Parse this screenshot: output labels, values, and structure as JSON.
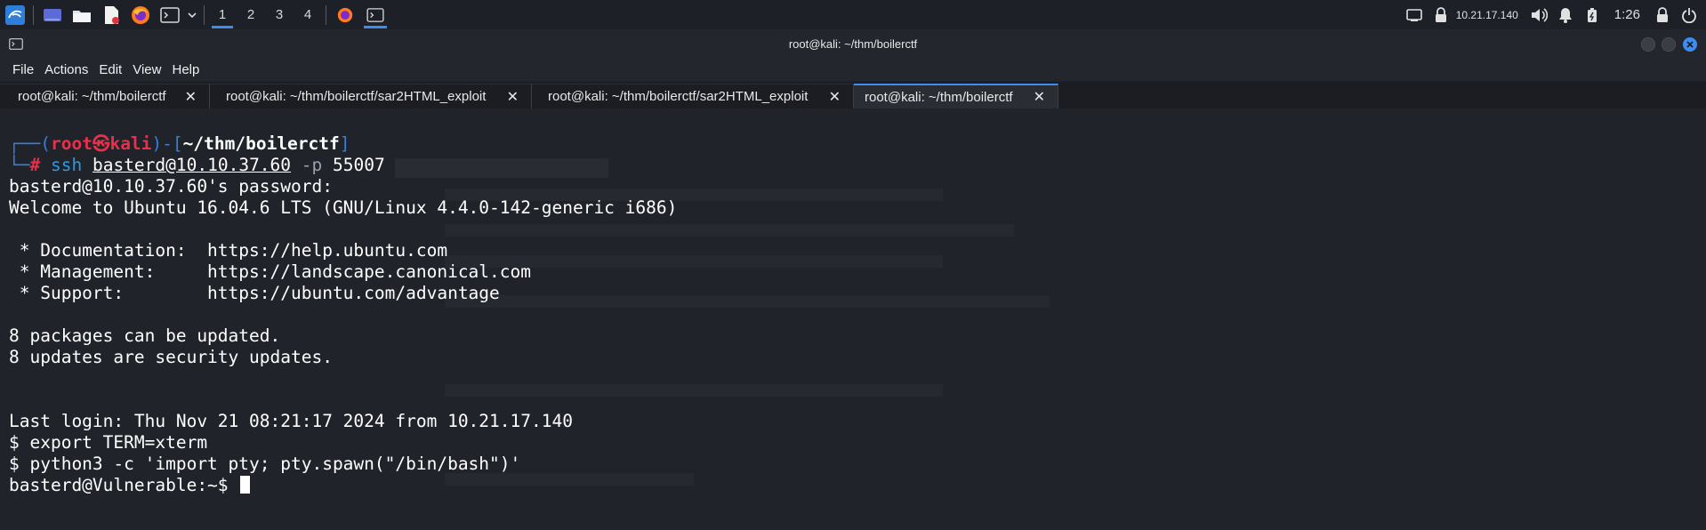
{
  "panel": {
    "workspaces": [
      "1",
      "2",
      "3",
      "4"
    ],
    "active_workspace": "1",
    "ip": "10.21.17.140",
    "clock": "1:26",
    "accent": "#3d8cf0"
  },
  "window": {
    "title": "root@kali: ~/thm/boilerctf"
  },
  "menu": [
    "File",
    "Actions",
    "Edit",
    "View",
    "Help"
  ],
  "tabs": [
    {
      "label": "root@kali: ~/thm/boilerctf"
    },
    {
      "label": "root@kali: ~/thm/boilerctf/sar2HTML_exploit"
    },
    {
      "label": "root@kali: ~/thm/boilerctf/sar2HTML_exploit"
    },
    {
      "label": "root@kali: ~/thm/boilerctf"
    }
  ],
  "terminal": {
    "prompt": {
      "user": "root",
      "at": "㉿",
      "host": "kali",
      "cwd": "~/thm/boilerctf",
      "hash": "#",
      "cmd": "ssh",
      "target": "basterd@10.10.37.60",
      "flag": "-p",
      "port": "55007"
    },
    "lines": [
      "basterd@10.10.37.60's password: ",
      "Welcome to Ubuntu 16.04.6 LTS (GNU/Linux 4.4.0-142-generic i686)",
      "",
      " * Documentation:  https://help.ubuntu.com",
      " * Management:     https://landscape.canonical.com",
      " * Support:        https://ubuntu.com/advantage",
      "",
      "8 packages can be updated.",
      "8 updates are security updates.",
      "",
      "",
      "Last login: Thu Nov 21 08:21:17 2024 from 10.21.17.140",
      "$ export TERM=xterm",
      "$ python3 -c 'import pty; pty.spawn(\"/bin/bash\")'",
      "basterd@Vulnerable:~$ "
    ]
  }
}
